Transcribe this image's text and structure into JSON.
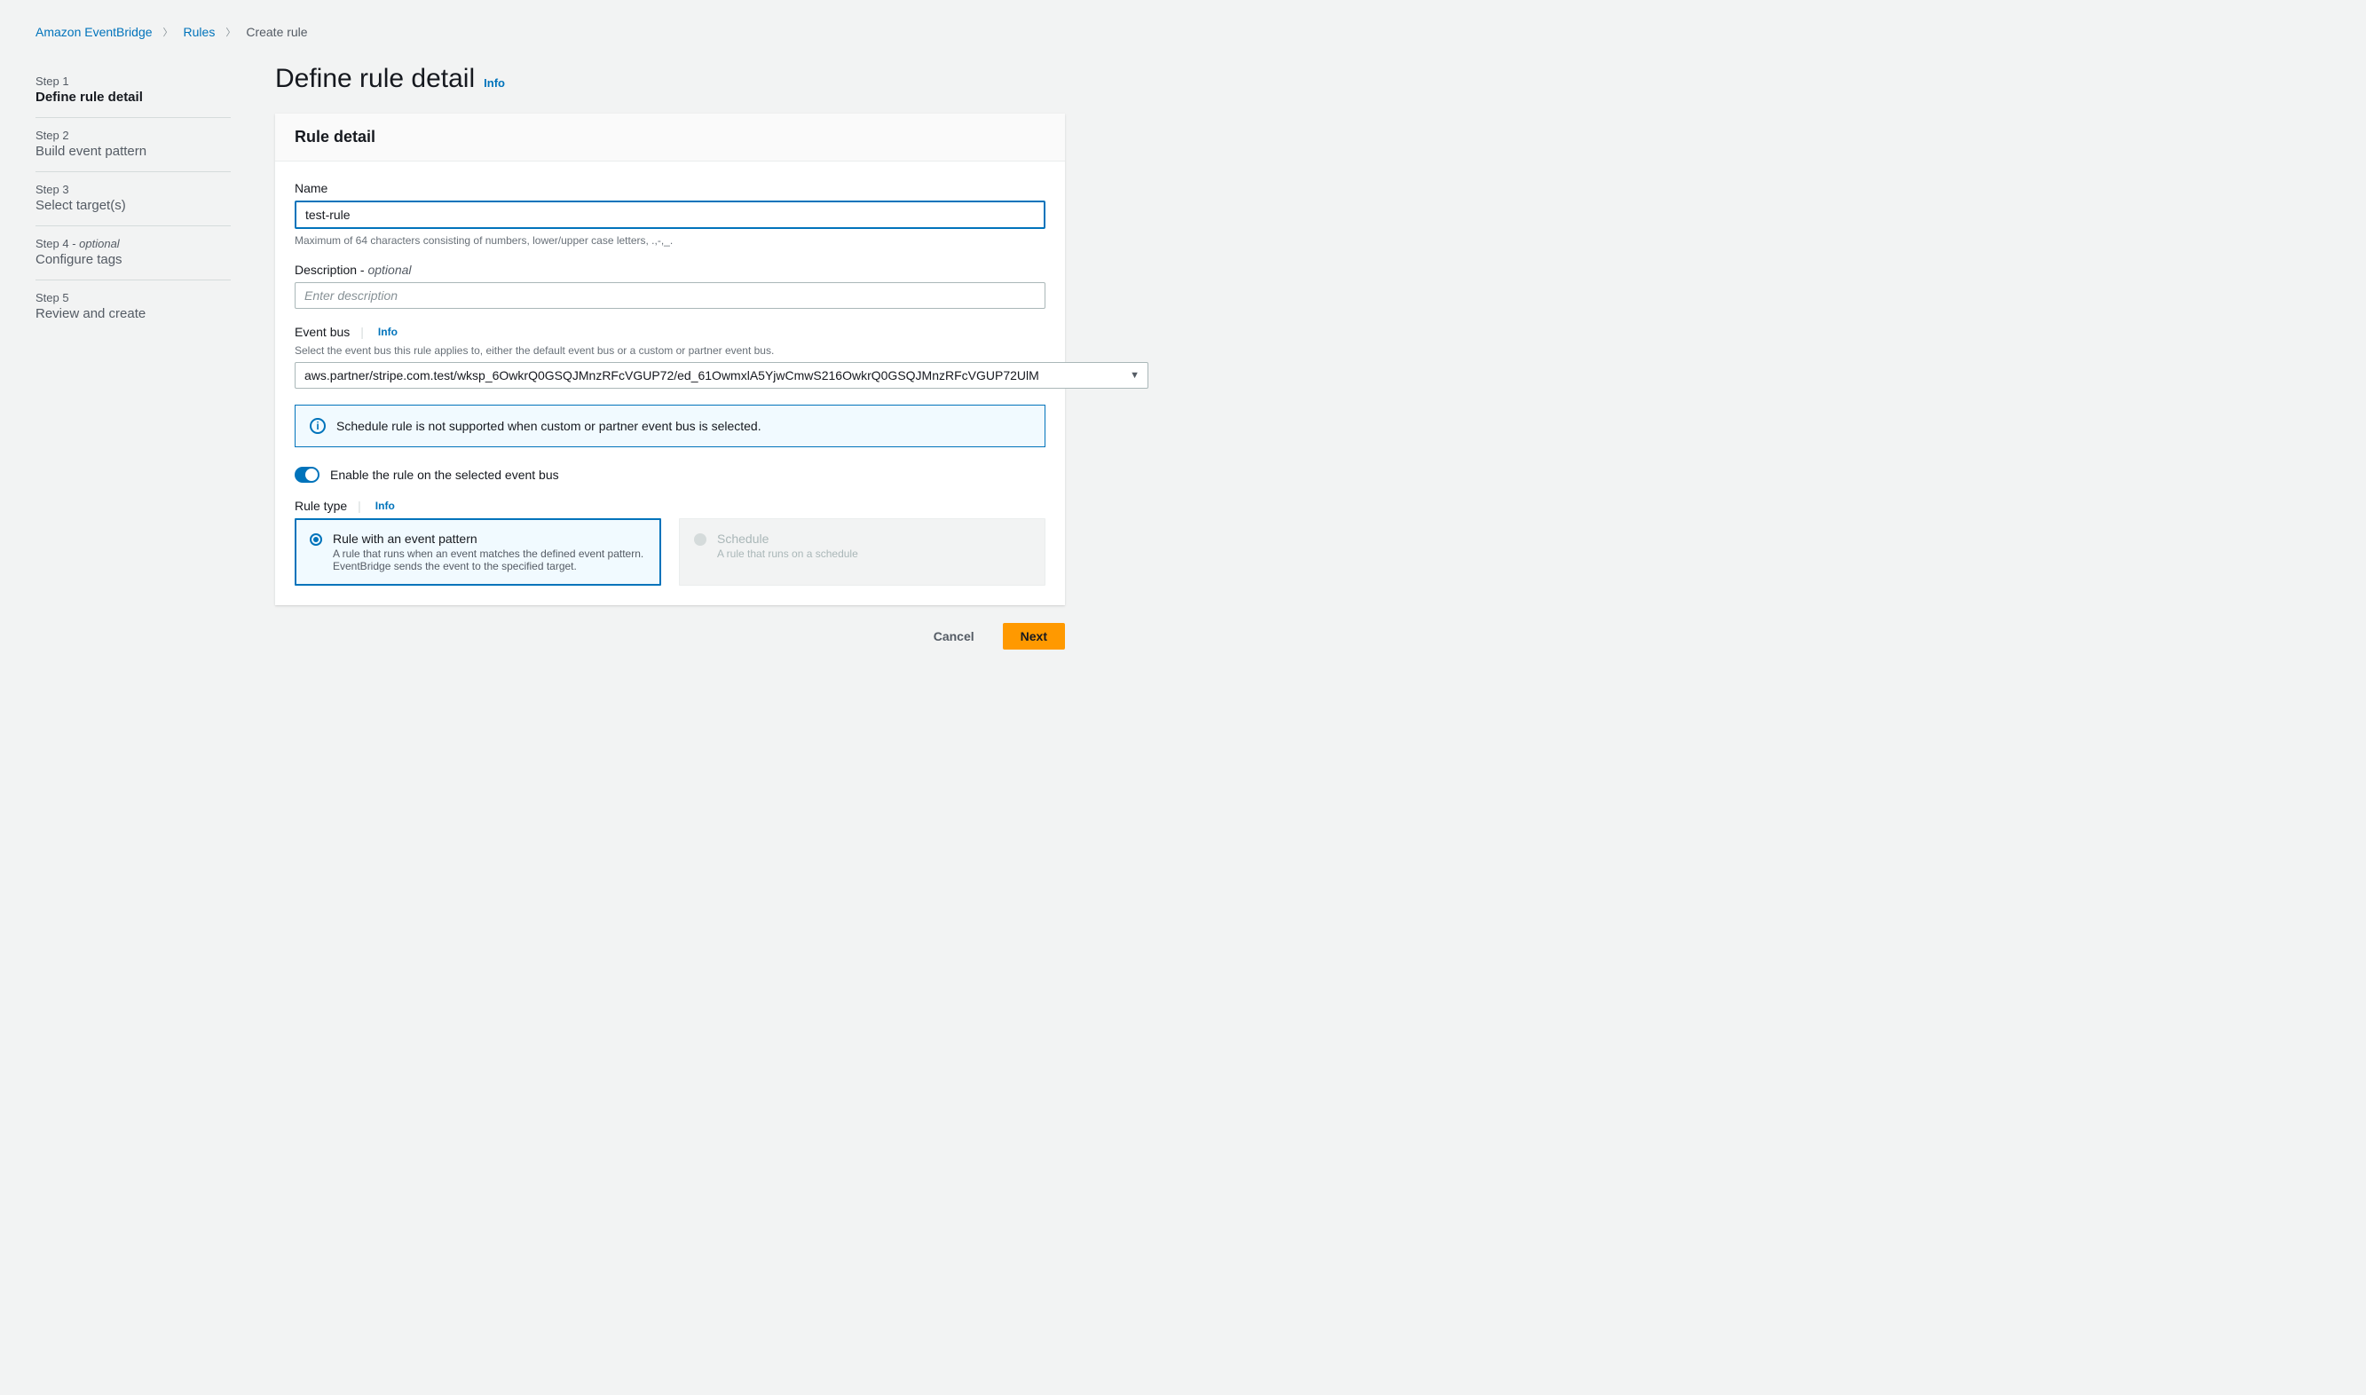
{
  "breadcrumb": {
    "root": "Amazon EventBridge",
    "rules": "Rules",
    "current": "Create rule"
  },
  "steps": [
    {
      "num": "Step 1",
      "title": "Define rule detail",
      "optional": false
    },
    {
      "num": "Step 2",
      "title": "Build event pattern",
      "optional": false
    },
    {
      "num": "Step 3",
      "title": "Select target(s)",
      "optional": false
    },
    {
      "num": "Step 4",
      "title": "Configure tags",
      "optional": true
    },
    {
      "num": "Step 5",
      "title": "Review and create",
      "optional": false
    }
  ],
  "page": {
    "title": "Define rule detail",
    "info": "Info"
  },
  "panel": {
    "header": "Rule detail",
    "name": {
      "label": "Name",
      "value": "test-rule",
      "hint": "Maximum of 64 characters consisting of numbers, lower/upper case letters, .,-,_."
    },
    "description": {
      "label": "Description - ",
      "optional": "optional",
      "value": "",
      "placeholder": "Enter description"
    },
    "eventbus": {
      "label": "Event bus",
      "info": "Info",
      "hint": "Select the event bus this rule applies to, either the default event bus or a custom or partner event bus.",
      "value": "aws.partner/stripe.com.test/wksp_6OwkrQ0GSQJMnzRFcVGUP72/ed_61OwmxlA5YjwCmwS216OwkrQ0GSQJMnzRFcVGUP72UlM"
    },
    "alert": "Schedule rule is not supported when custom or partner event bus is selected.",
    "toggle": {
      "label": "Enable the rule on the selected event bus",
      "on": true
    },
    "ruletype": {
      "label": "Rule type",
      "info": "Info",
      "tile1": {
        "title": "Rule with an event pattern",
        "desc": "A rule that runs when an event matches the defined event pattern. EventBridge sends the event to the specified target."
      },
      "tile2": {
        "title": "Schedule",
        "desc": "A rule that runs on a schedule"
      }
    }
  },
  "footer": {
    "cancel": "Cancel",
    "next": "Next"
  },
  "optional_word": "optional"
}
